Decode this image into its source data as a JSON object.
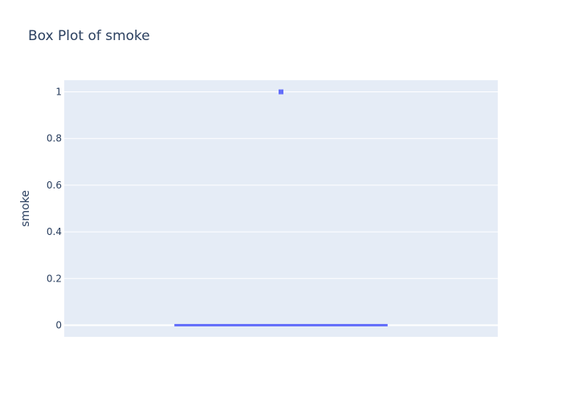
{
  "chart_data": {
    "type": "box",
    "title": "Box Plot of smoke",
    "xlabel": "",
    "ylabel": "smoke",
    "ylim": [
      -0.05,
      1.05
    ],
    "yticks": [
      0,
      0.2,
      0.4,
      0.6,
      0.8,
      1
    ],
    "ytick_labels": [
      "0",
      "0.2",
      "0.4",
      "0.6",
      "0.8",
      "1"
    ],
    "grid": true,
    "legend": "none",
    "series": [
      {
        "min": 0,
        "q1": 0,
        "median": 0,
        "q3": 0,
        "max": 0,
        "outliers": [
          1
        ]
      }
    ],
    "colors": {
      "plot_bg": "#e5ecf6",
      "grid": "#ffffff",
      "text": "#2a3f5f",
      "box": "#636efa"
    }
  }
}
